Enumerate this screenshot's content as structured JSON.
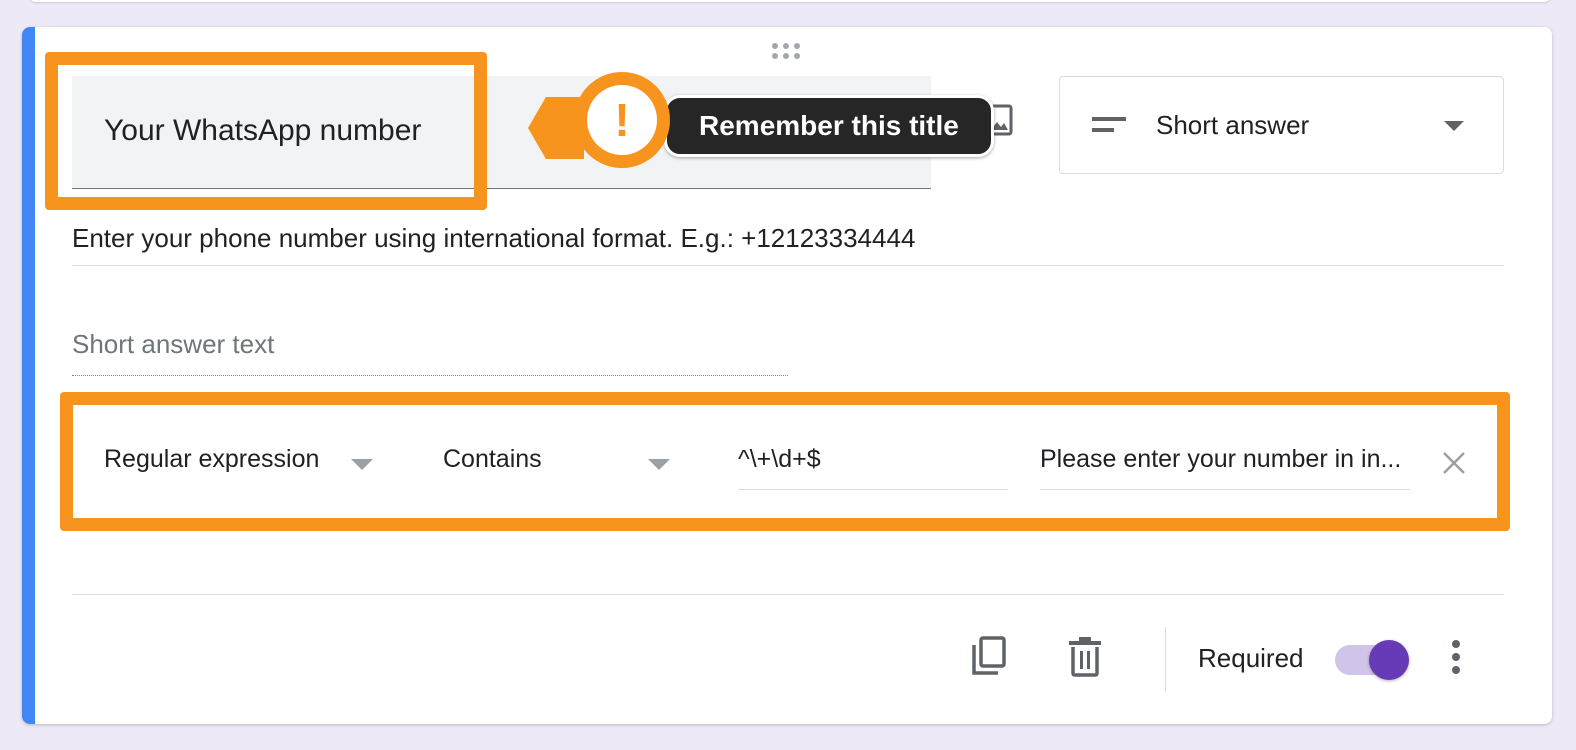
{
  "colors": {
    "accent": "#4285f4",
    "highlight": "#f7941d",
    "toggle_thumb": "#673ab7",
    "toggle_track": "#d1c4e9"
  },
  "question": {
    "title": "Your WhatsApp number",
    "description": "Enter your phone number using international format. E.g.: +12123334444",
    "answer_placeholder": "Short answer text",
    "type": "Short answer",
    "type_icon": "short-text-icon",
    "image_icon": "add-image-icon"
  },
  "validation": {
    "type": "Regular expression",
    "condition": "Contains",
    "pattern": "^\\+\\d+$",
    "error_text": "Please enter your number in in..."
  },
  "footer": {
    "icons": [
      "duplicate-icon",
      "delete-icon",
      "more-vert-icon"
    ],
    "required_label": "Required",
    "required_on": true
  },
  "annotation": {
    "callout_symbol": "!",
    "callout_text": "Remember this title"
  }
}
